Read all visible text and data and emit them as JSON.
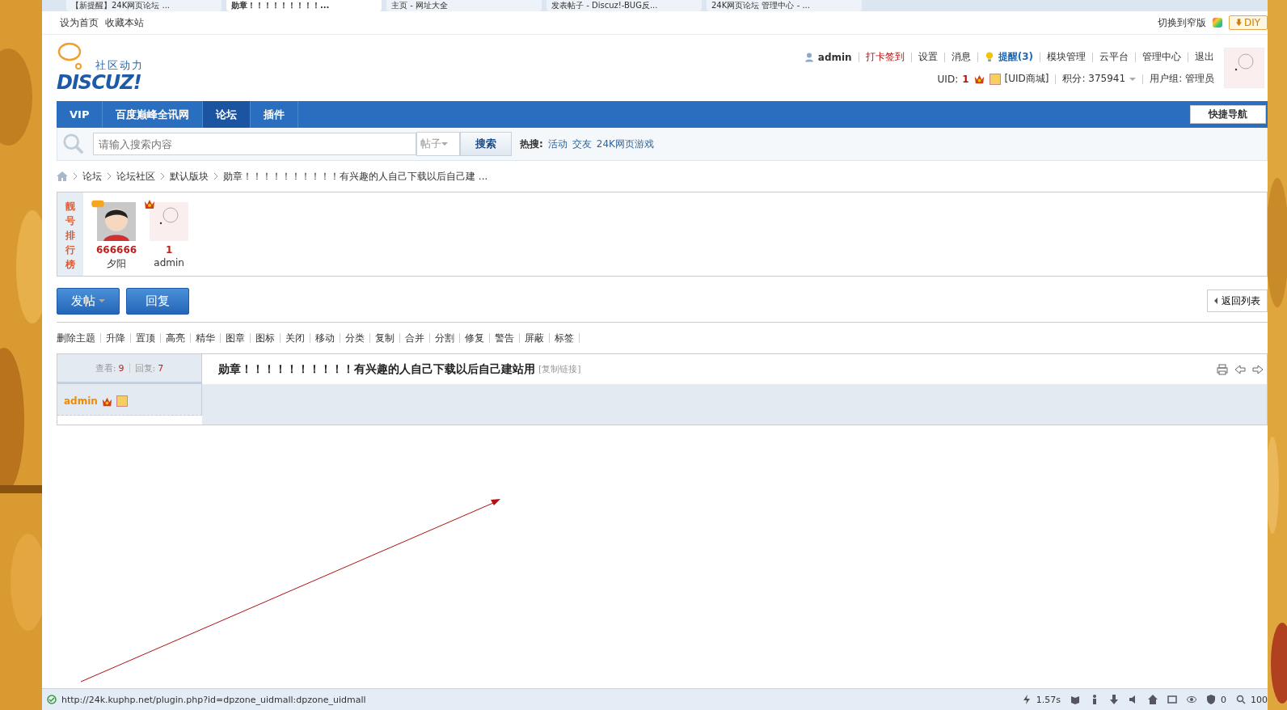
{
  "browser_tabs": [
    {
      "label": "【新提醒】24K网页论坛 ...",
      "selected": false
    },
    {
      "label": "勋章！！！！！！！！！...",
      "selected": true
    },
    {
      "label": "主页 - 网址大全",
      "selected": false
    },
    {
      "label": "发表帖子 - Discuz!-BUG反...",
      "selected": false
    },
    {
      "label": "24K网页论坛 管理中心 - ...",
      "selected": false
    }
  ],
  "topbar": {
    "links": [
      "设为首页",
      "收藏本站"
    ],
    "switch_width": "切换到窄版",
    "diy": "DIY"
  },
  "logo": {
    "tagline": "社区动力",
    "name": "DISCUZ!"
  },
  "user_menu": {
    "username": "admin",
    "items": [
      {
        "label": "打卡签到",
        "kind": "highlight"
      },
      {
        "label": "设置",
        "kind": "plain"
      },
      {
        "label": "消息",
        "kind": "plain"
      },
      {
        "label": "提醒(3)",
        "kind": "notice"
      },
      {
        "label": "模块管理",
        "kind": "plain"
      },
      {
        "label": "云平台",
        "kind": "plain"
      },
      {
        "label": "管理中心",
        "kind": "plain"
      },
      {
        "label": "退出",
        "kind": "plain"
      }
    ],
    "uid_label": "UID:",
    "uid": "1",
    "shop": "[UID商城]",
    "credits": "积分: 375941",
    "group": "用户组: 管理员"
  },
  "nav": {
    "items": [
      {
        "label": "VIP",
        "selected": false
      },
      {
        "label": "百度巅峰全讯网",
        "selected": false
      },
      {
        "label": "论坛",
        "selected": true
      },
      {
        "label": "插件",
        "selected": false
      }
    ],
    "quick_nav": "快捷导航"
  },
  "search": {
    "placeholder": "请输入搜索内容",
    "type": "帖子",
    "button": "搜索",
    "hot_label": "热搜:",
    "hot": [
      "活动",
      "交友",
      "24K网页游戏"
    ]
  },
  "breadcrumb": [
    "论坛",
    "论坛社区",
    "默认版块",
    "勋章！！！！！！！！！！有兴趣的人自己下载以后自己建 ..."
  ],
  "ranking": {
    "title": "靓号排行榜",
    "users": [
      {
        "number": "666666",
        "name": "夕阳"
      },
      {
        "number": "1",
        "name": "admin"
      }
    ]
  },
  "actions": {
    "post": "发帖",
    "reply": "回复",
    "back": "返回列表"
  },
  "mod_tools": [
    "删除主题",
    "升降",
    "置顶",
    "高亮",
    "精华",
    "图章",
    "图标",
    "关闭",
    "移动",
    "分类",
    "复制",
    "合并",
    "分割",
    "修复",
    "警告",
    "屏蔽",
    "标签"
  ],
  "thread": {
    "views_label": "查看:",
    "views": "9",
    "replies_label": "回复:",
    "replies": "7",
    "title": "勋章！！！！！！！！！！有兴趣的人自己下载以后自己建站用",
    "copy_link": "[复制链接]",
    "author": "admin"
  },
  "status_bar": {
    "url": "http://24k.kuphp.net/plugin.php?id=dpzone_uidmall:dpzone_uidmall",
    "time": "1.57s",
    "count": "0",
    "zoom": "100"
  }
}
